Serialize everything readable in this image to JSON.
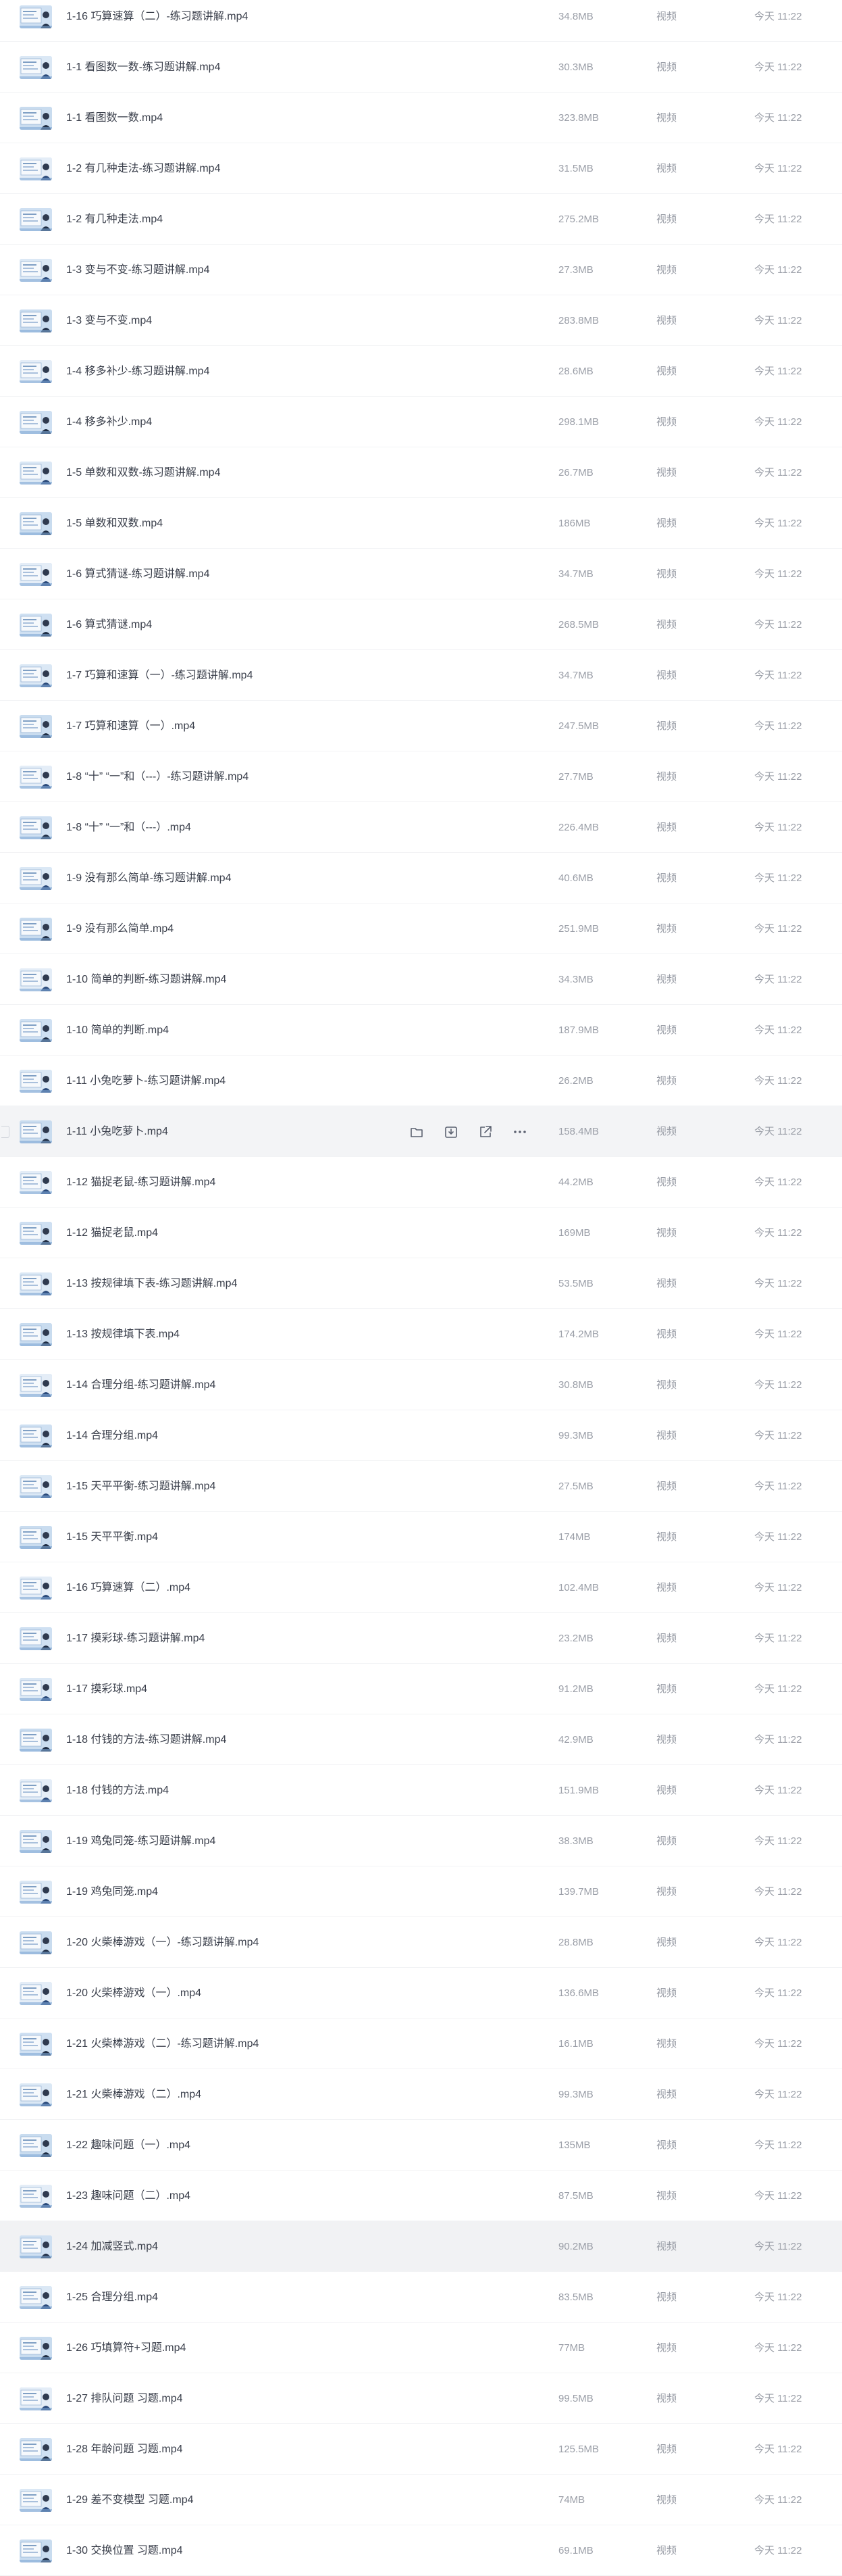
{
  "kind_label": "视频",
  "time_label": "今天 11:22",
  "hover_index": 22,
  "selected_index": 44,
  "row_actions": [
    {
      "name": "move-folder-icon"
    },
    {
      "name": "download-icon"
    },
    {
      "name": "share-icon"
    },
    {
      "name": "more-icon"
    }
  ],
  "files": [
    {
      "name": "1-16 巧算速算（二）-练习题讲解.mp4",
      "size": "34.8MB"
    },
    {
      "name": "1-1 看图数一数-练习题讲解.mp4",
      "size": "30.3MB"
    },
    {
      "name": "1-1 看图数一数.mp4",
      "size": "323.8MB"
    },
    {
      "name": "1-2 有几种走法-练习题讲解.mp4",
      "size": "31.5MB"
    },
    {
      "name": "1-2 有几种走法.mp4",
      "size": "275.2MB"
    },
    {
      "name": "1-3 变与不变-练习题讲解.mp4",
      "size": "27.3MB"
    },
    {
      "name": "1-3 变与不变.mp4",
      "size": "283.8MB"
    },
    {
      "name": "1-4 移多补少-练习题讲解.mp4",
      "size": "28.6MB"
    },
    {
      "name": "1-4 移多补少.mp4",
      "size": "298.1MB"
    },
    {
      "name": "1-5 单数和双数-练习题讲解.mp4",
      "size": "26.7MB"
    },
    {
      "name": "1-5 单数和双数.mp4",
      "size": "186MB"
    },
    {
      "name": "1-6 算式猜谜-练习题讲解.mp4",
      "size": "34.7MB"
    },
    {
      "name": "1-6 算式猜谜.mp4",
      "size": "268.5MB"
    },
    {
      "name": "1-7 巧算和速算（一）-练习题讲解.mp4",
      "size": "34.7MB"
    },
    {
      "name": "1-7 巧算和速算（一）.mp4",
      "size": "247.5MB"
    },
    {
      "name": "1-8 “十” “一”和（---）-练习题讲解.mp4",
      "size": "27.7MB"
    },
    {
      "name": "1-8 “十” “一”和（---）.mp4",
      "size": "226.4MB"
    },
    {
      "name": "1-9 没有那么简单-练习题讲解.mp4",
      "size": "40.6MB"
    },
    {
      "name": "1-9 没有那么简单.mp4",
      "size": "251.9MB"
    },
    {
      "name": "1-10 简单的判断-练习题讲解.mp4",
      "size": "34.3MB"
    },
    {
      "name": "1-10 简单的判断.mp4",
      "size": "187.9MB"
    },
    {
      "name": "1-11 小兔吃萝卜-练习题讲解.mp4",
      "size": "26.2MB"
    },
    {
      "name": "1-11 小兔吃萝卜.mp4",
      "size": "158.4MB"
    },
    {
      "name": "1-12 猫捉老鼠-练习题讲解.mp4",
      "size": "44.2MB"
    },
    {
      "name": "1-12 猫捉老鼠.mp4",
      "size": "169MB"
    },
    {
      "name": "1-13 按规律填下表-练习题讲解.mp4",
      "size": "53.5MB"
    },
    {
      "name": "1-13 按规律填下表.mp4",
      "size": "174.2MB"
    },
    {
      "name": "1-14 合理分组-练习题讲解.mp4",
      "size": "30.8MB"
    },
    {
      "name": "1-14 合理分组.mp4",
      "size": "99.3MB"
    },
    {
      "name": "1-15 天平平衡-练习题讲解.mp4",
      "size": "27.5MB"
    },
    {
      "name": "1-15 天平平衡.mp4",
      "size": "174MB"
    },
    {
      "name": "1-16 巧算速算（二）.mp4",
      "size": "102.4MB"
    },
    {
      "name": "1-17 摸彩球-练习题讲解.mp4",
      "size": "23.2MB"
    },
    {
      "name": "1-17 摸彩球.mp4",
      "size": "91.2MB"
    },
    {
      "name": "1-18 付钱的方法-练习题讲解.mp4",
      "size": "42.9MB"
    },
    {
      "name": "1-18 付钱的方法.mp4",
      "size": "151.9MB"
    },
    {
      "name": "1-19 鸡兔同笼-练习题讲解.mp4",
      "size": "38.3MB"
    },
    {
      "name": "1-19 鸡兔同笼.mp4",
      "size": "139.7MB"
    },
    {
      "name": "1-20 火柴棒游戏（一）-练习题讲解.mp4",
      "size": "28.8MB"
    },
    {
      "name": "1-20 火柴棒游戏（一）.mp4",
      "size": "136.6MB"
    },
    {
      "name": "1-21 火柴棒游戏（二）-练习题讲解.mp4",
      "size": "16.1MB"
    },
    {
      "name": "1-21 火柴棒游戏（二）.mp4",
      "size": "99.3MB"
    },
    {
      "name": "1-22 趣味问题（一）.mp4",
      "size": "135MB"
    },
    {
      "name": "1-23 趣味问题（二）.mp4",
      "size": "87.5MB"
    },
    {
      "name": "1-24 加减竖式.mp4",
      "size": "90.2MB"
    },
    {
      "name": "1-25 合理分组.mp4",
      "size": "83.5MB"
    },
    {
      "name": "1-26 巧填算符+习题.mp4",
      "size": "77MB"
    },
    {
      "name": "1-27 排队问题 习题.mp4",
      "size": "99.5MB"
    },
    {
      "name": "1-28 年龄问题 习题.mp4",
      "size": "125.5MB"
    },
    {
      "name": "1-29 差不变模型 习题.mp4",
      "size": "74MB"
    },
    {
      "name": "1-30 交换位置 习题.mp4",
      "size": "69.1MB"
    }
  ]
}
